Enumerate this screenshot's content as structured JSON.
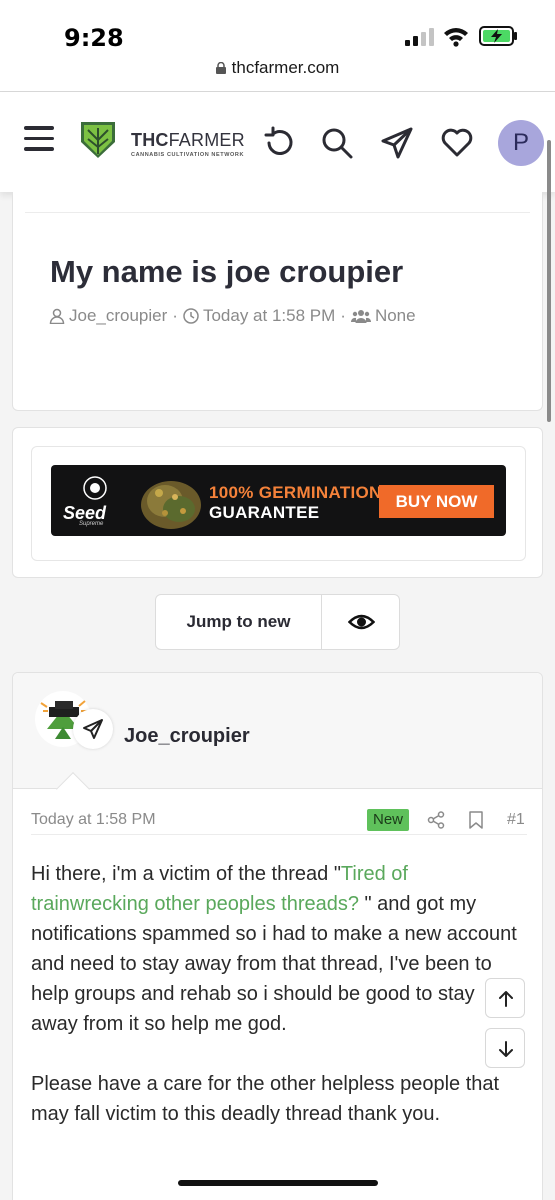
{
  "status_bar": {
    "time": "9:28",
    "url": "thcfarmer.com"
  },
  "header": {
    "logo_bold": "THC",
    "logo_rest": "FARMER",
    "logo_tagline": "CANNABIS CULTIVATION NETWORK",
    "avatar_letter": "P"
  },
  "thread": {
    "title": "My name is joe croupier",
    "author": "Joe_croupier",
    "date": "Today at 1:58 PM",
    "audience": "None"
  },
  "ad": {
    "brand": "Seed",
    "brand_sub": "Supreme",
    "headline_1": "100% GERMINATION",
    "headline_2": "GUARANTEE",
    "cta": "BUY NOW"
  },
  "actions": {
    "jump_label": "Jump to new"
  },
  "post": {
    "author": "Joe_croupier",
    "date": "Today at 1:58 PM",
    "badge": "New",
    "number": "#1",
    "body_1a": "Hi there, i'm a victim of the thread \"",
    "body_link": "Tired of trainwrecking other peoples threads?",
    "body_1b": " \" and got my notifications spammed so i had to make a new account and need to stay away from that thread, I've been to help groups and rehab so i should be good to stay away from it so help me god.",
    "body_2": "Please have a care for the other helpless people that may fall victim to this deadly thread thank you."
  },
  "colors": {
    "accent_green": "#5fc15b",
    "link_green": "#5aa85c",
    "avatar_purple": "#a8a6dc",
    "ad_orange": "#f06a29"
  }
}
